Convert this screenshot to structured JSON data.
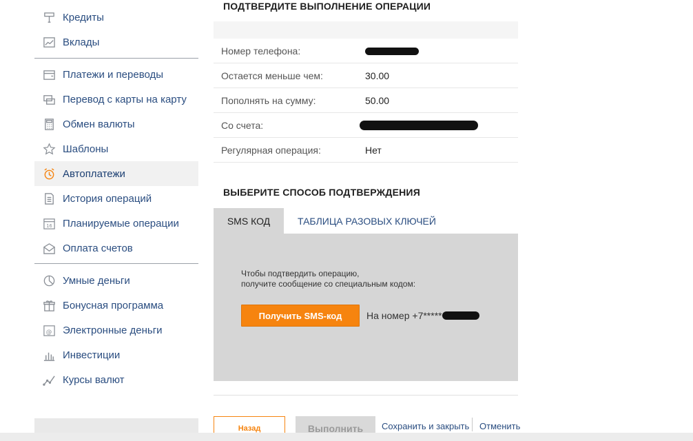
{
  "colors": {
    "link": "#2a4d80",
    "accent_orange": "#f6840f",
    "panel_gray": "#d6d6d6",
    "icon": "#8a8f96",
    "active_icon": "#f6840f"
  },
  "sidebar": {
    "groups": [
      [
        {
          "label": "Кредиты",
          "icon": "loan-icon"
        },
        {
          "label": "Вклады",
          "icon": "chart-icon"
        }
      ],
      [
        {
          "label": "Платежи и переводы",
          "icon": "wallet-icon"
        },
        {
          "label": "Перевод с карты на карту",
          "icon": "card-transfer-icon"
        },
        {
          "label": "Обмен валюты",
          "icon": "calculator-icon"
        },
        {
          "label": "Шаблоны",
          "icon": "star-icon"
        },
        {
          "label": "Автоплатежи",
          "icon": "alarm-clock-icon",
          "active": true
        },
        {
          "label": "История операций",
          "icon": "document-icon"
        },
        {
          "label": "Планируемые операции",
          "icon": "calendar-icon"
        },
        {
          "label": "Оплата счетов",
          "icon": "envelope-icon"
        }
      ],
      [
        {
          "label": "Умные деньги",
          "icon": "pie-chart-icon"
        },
        {
          "label": "Бонусная программа",
          "icon": "gift-icon"
        },
        {
          "label": "Электронные деньги",
          "icon": "e-money-icon"
        },
        {
          "label": "Инвестиции",
          "icon": "bar-chart-icon"
        },
        {
          "label": "Курсы валют",
          "icon": "line-chart-icon"
        }
      ]
    ]
  },
  "confirm": {
    "title": "ПОДТВЕРДИТЕ ВЫПОЛНЕНИЕ ОПЕРАЦИИ",
    "rows": [
      {
        "label": "Номер телефона:",
        "value": "",
        "redacted": true
      },
      {
        "label": "Остается меньше чем:",
        "value": "30.00"
      },
      {
        "label": "Пополнять на сумму:",
        "value": "50.00"
      },
      {
        "label": "Со счета:",
        "value": "",
        "redacted": true
      },
      {
        "label": "Регулярная операция:",
        "value": "Нет"
      }
    ]
  },
  "method": {
    "title": "ВЫБЕРИТЕ СПОСОБ ПОДТВЕРЖДЕНИЯ",
    "tabs": [
      {
        "label": "SMS КОД",
        "active": true
      },
      {
        "label": "ТАБЛИЦА РАЗОВЫХ КЛЮЧЕЙ",
        "active": false
      }
    ],
    "instruction_line1": "Чтобы подтвердить операцию,",
    "instruction_line2": "получите сообщение со специальным кодом:",
    "sms_button": "Получить SMS-код",
    "phone_note": "На номер +7*****"
  },
  "actions": {
    "back": "Назад",
    "execute": "Выполнить",
    "save_close": "Сохранить и закрыть",
    "cancel": "Отменить"
  }
}
